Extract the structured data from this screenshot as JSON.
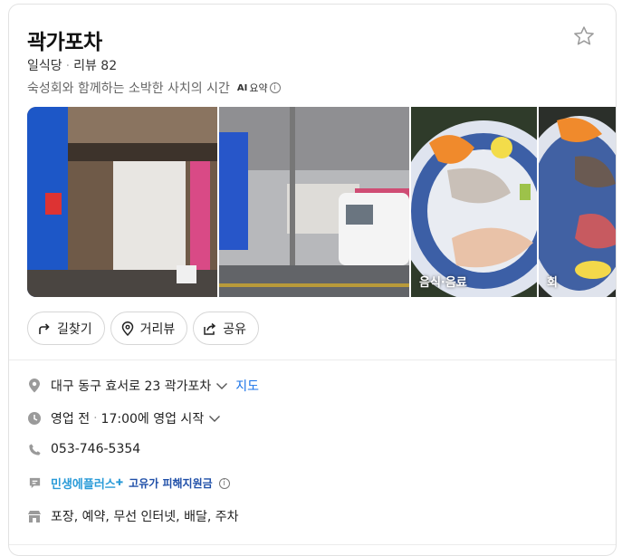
{
  "place": {
    "name": "곽가포차",
    "category": "일식당",
    "review_label": "리뷰 82",
    "description": "숙성회와 함께하는 소박한 사치의 시간",
    "ai_summary_label": "요약",
    "ai_prefix": "AI"
  },
  "gallery": {
    "labels": [
      "음식·음료",
      "회"
    ]
  },
  "actions": {
    "directions": "길찾기",
    "street_view": "거리뷰",
    "share": "공유"
  },
  "info": {
    "address": "대구 동구 효서로 23 곽가포차",
    "map_link": "지도",
    "status": "영업 전",
    "hours": "17:00에 영업 시작",
    "phone": "053-746-5354",
    "promo_brand": "민생에플러스",
    "promo_text": "고유가 피해지원금",
    "amenities": "포장, 예약, 무선 인터넷, 배달, 주차"
  },
  "colors": {
    "link": "#1a73e8",
    "promo": "#2a9bd8"
  }
}
